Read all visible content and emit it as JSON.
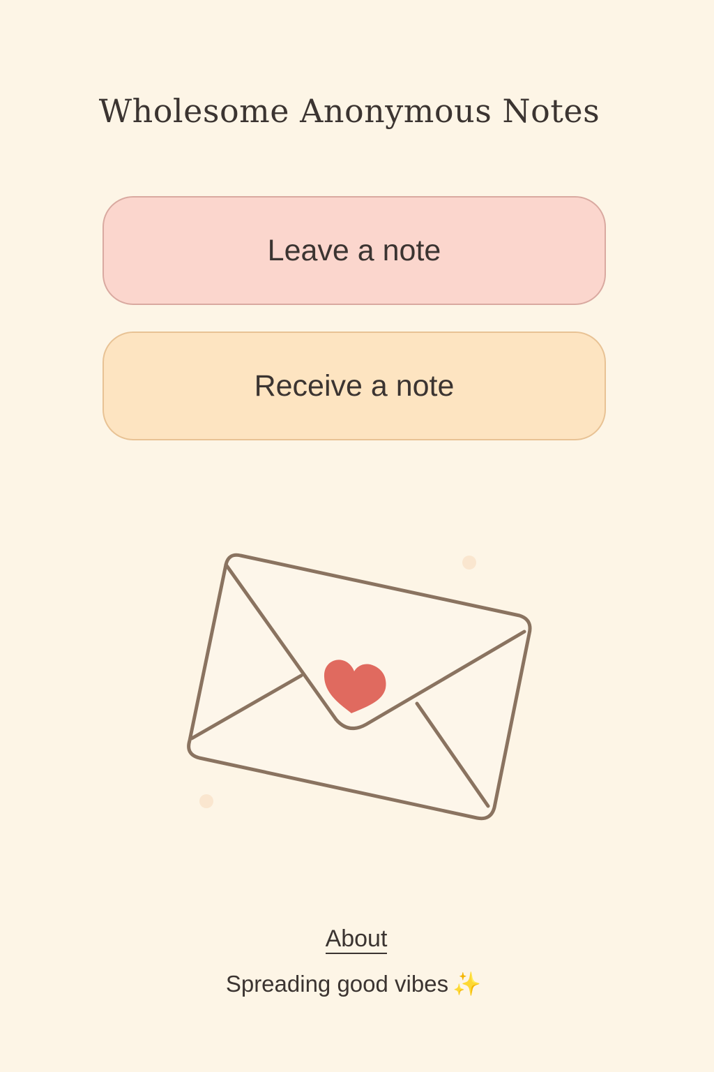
{
  "header": {
    "title": "Wholesome Anonymous Notes"
  },
  "actions": {
    "leave_label": "Leave a note",
    "receive_label": "Receive a note"
  },
  "illustration": {
    "icon": "envelope-heart-icon",
    "stroke_color": "#8a7360",
    "heart_color": "#e06a5f",
    "envelope_fill": "#fdf6ea"
  },
  "footer": {
    "about_label": "About",
    "tagline": "Spreading good vibes",
    "tagline_icon": "sparkles-icon",
    "sparkle_glyph": "✨"
  },
  "colors": {
    "background": "#fdf5e6",
    "leave_button": "#fbd6cd",
    "receive_button": "#fde4c1",
    "text": "#3b3431"
  }
}
